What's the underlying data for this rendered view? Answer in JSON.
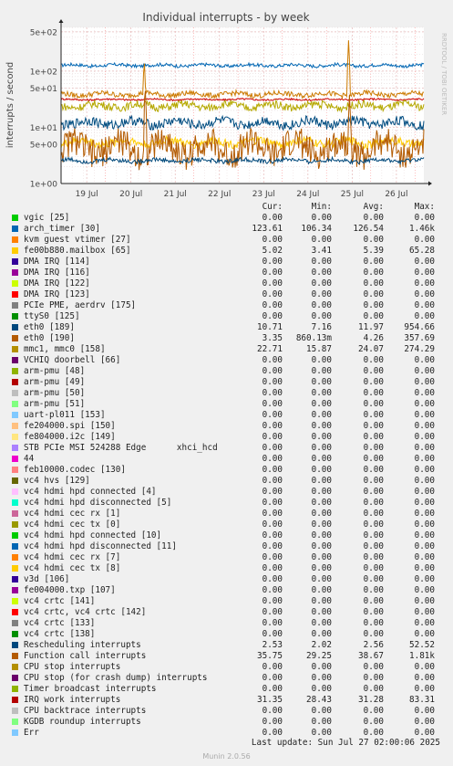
{
  "title": "Individual interrupts - by week",
  "ylabel": "interrupts / second",
  "watermark": "RRDTOOL / TOBI OETIKER",
  "columns": [
    "Cur:",
    "Min:",
    "Avg:",
    "Max:"
  ],
  "last_update": "Last update: Sun Jul 27 02:00:06 2025",
  "munin": "Munin 2.0.56",
  "chart_data": {
    "type": "line",
    "yscale": "log",
    "ylim": [
      1,
      600
    ],
    "yticks": [
      {
        "v": 500,
        "label": "5e+02"
      },
      {
        "v": 100,
        "label": "1e+02"
      },
      {
        "v": 50,
        "label": "5e+01"
      },
      {
        "v": 10,
        "label": "1e+01"
      },
      {
        "v": 5,
        "label": "5e+00"
      },
      {
        "v": 1,
        "label": "1e+00"
      }
    ],
    "xlim": [
      0,
      8.2
    ],
    "xticks": [
      {
        "v": 0.58,
        "label": "19 Jul"
      },
      {
        "v": 1.58,
        "label": "20 Jul"
      },
      {
        "v": 2.58,
        "label": "21 Jul"
      },
      {
        "v": 3.58,
        "label": "22 Jul"
      },
      {
        "v": 4.58,
        "label": "23 Jul"
      },
      {
        "v": 5.58,
        "label": "24 Jul"
      },
      {
        "v": 6.58,
        "label": "25 Jul"
      },
      {
        "v": 7.58,
        "label": "26 Jul"
      }
    ],
    "grid": true,
    "series": [
      {
        "name": "arch_timer [30]",
        "color": "#0066b3",
        "avg": 126.54,
        "lo": 106.34,
        "spikes": []
      },
      {
        "name": "IRQ work interrupts",
        "color": "#cc0000",
        "avg": 31.28,
        "lo": 28.43,
        "spikes": []
      },
      {
        "name": "Function call interrupts",
        "color": "#cc7a00",
        "avg": 38.67,
        "lo": 29.25,
        "spikes": [
          [
            1.88,
            180
          ],
          [
            6.5,
            380
          ]
        ]
      },
      {
        "name": "mmc1, mmc0 [158]",
        "color": "#b5a800",
        "avg": 24.07,
        "lo": 15.87,
        "spikes": []
      },
      {
        "name": "eth0 [189]",
        "color": "#004c80",
        "avg": 11.97,
        "lo": 7.16,
        "spikes": []
      },
      {
        "name": "fe00b880.mailbox [65]",
        "color": "#ffcc00",
        "avg": 5.39,
        "lo": 3.41,
        "spikes": []
      },
      {
        "name": "eth0 [190]",
        "color": "#b35a00",
        "avg": 4.26,
        "lo": 0.86,
        "spikes": [
          [
            1.9,
            60
          ],
          [
            6.52,
            40
          ]
        ]
      },
      {
        "name": "Rescheduling interrupts",
        "color": "#00487a",
        "avg": 2.56,
        "lo": 2.02,
        "spikes": []
      }
    ]
  },
  "legend": [
    {
      "name": "vgic [25]",
      "color": "#00cc00",
      "cur": "0.00",
      "min": "0.00",
      "avg": "0.00",
      "max": "0.00"
    },
    {
      "name": "arch_timer [30]",
      "color": "#0066b3",
      "cur": "123.61",
      "min": "106.34",
      "avg": "126.54",
      "max": "1.46k"
    },
    {
      "name": "kvm guest vtimer [27]",
      "color": "#ff8000",
      "cur": "0.00",
      "min": "0.00",
      "avg": "0.00",
      "max": "0.00"
    },
    {
      "name": "fe00b880.mailbox [65]",
      "color": "#ffcc00",
      "cur": "5.02",
      "min": "3.41",
      "avg": "5.39",
      "max": "65.28"
    },
    {
      "name": "DMA IRQ [114]",
      "color": "#330099",
      "cur": "0.00",
      "min": "0.00",
      "avg": "0.00",
      "max": "0.00"
    },
    {
      "name": "DMA IRQ [116]",
      "color": "#990099",
      "cur": "0.00",
      "min": "0.00",
      "avg": "0.00",
      "max": "0.00"
    },
    {
      "name": "DMA IRQ [122]",
      "color": "#ccff00",
      "cur": "0.00",
      "min": "0.00",
      "avg": "0.00",
      "max": "0.00"
    },
    {
      "name": "DMA IRQ [123]",
      "color": "#ff0000",
      "cur": "0.00",
      "min": "0.00",
      "avg": "0.00",
      "max": "0.00"
    },
    {
      "name": "PCIe PME, aerdrv [175]",
      "color": "#808080",
      "cur": "0.00",
      "min": "0.00",
      "avg": "0.00",
      "max": "0.00"
    },
    {
      "name": "ttyS0 [125]",
      "color": "#008f00",
      "cur": "0.00",
      "min": "0.00",
      "avg": "0.00",
      "max": "0.00"
    },
    {
      "name": "eth0 [189]",
      "color": "#00487d",
      "cur": "10.71",
      "min": "7.16",
      "avg": "11.97",
      "max": "954.66"
    },
    {
      "name": "eth0 [190]",
      "color": "#b35a00",
      "cur": "3.35",
      "min": "860.13m",
      "avg": "4.26",
      "max": "357.69"
    },
    {
      "name": "mmc1, mmc0 [158]",
      "color": "#b38f00",
      "cur": "22.71",
      "min": "15.87",
      "avg": "24.07",
      "max": "274.29"
    },
    {
      "name": "VCHIQ doorbell [66]",
      "color": "#6b006b",
      "cur": "0.00",
      "min": "0.00",
      "avg": "0.00",
      "max": "0.00"
    },
    {
      "name": "arm-pmu [48]",
      "color": "#8fb300",
      "cur": "0.00",
      "min": "0.00",
      "avg": "0.00",
      "max": "0.00"
    },
    {
      "name": "arm-pmu [49]",
      "color": "#b30000",
      "cur": "0.00",
      "min": "0.00",
      "avg": "0.00",
      "max": "0.00"
    },
    {
      "name": "arm-pmu [50]",
      "color": "#bebebe",
      "cur": "0.00",
      "min": "0.00",
      "avg": "0.00",
      "max": "0.00"
    },
    {
      "name": "arm-pmu [51]",
      "color": "#80ff80",
      "cur": "0.00",
      "min": "0.00",
      "avg": "0.00",
      "max": "0.00"
    },
    {
      "name": "uart-pl011 [153]",
      "color": "#80c9ff",
      "cur": "0.00",
      "min": "0.00",
      "avg": "0.00",
      "max": "0.00"
    },
    {
      "name": "fe204000.spi [150]",
      "color": "#ffc080",
      "cur": "0.00",
      "min": "0.00",
      "avg": "0.00",
      "max": "0.00"
    },
    {
      "name": "fe804000.i2c [149]",
      "color": "#ffe680",
      "cur": "0.00",
      "min": "0.00",
      "avg": "0.00",
      "max": "0.00"
    },
    {
      "name": "STB PCIe MSI 524288 Edge      xhci_hcd",
      "color": "#aa80ff",
      "cur": "0.00",
      "min": "0.00",
      "avg": "0.00",
      "max": "0.00"
    },
    {
      "name": "44",
      "color": "#ee00cc",
      "cur": "0.00",
      "min": "0.00",
      "avg": "0.00",
      "max": "0.00"
    },
    {
      "name": "feb10000.codec [130]",
      "color": "#ff8080",
      "cur": "0.00",
      "min": "0.00",
      "avg": "0.00",
      "max": "0.00"
    },
    {
      "name": "vc4 hvs [129]",
      "color": "#666600",
      "cur": "0.00",
      "min": "0.00",
      "avg": "0.00",
      "max": "0.00"
    },
    {
      "name": "vc4 hdmi hpd connected [4]",
      "color": "#ffbfff",
      "cur": "0.00",
      "min": "0.00",
      "avg": "0.00",
      "max": "0.00"
    },
    {
      "name": "vc4 hdmi hpd disconnected [5]",
      "color": "#00ffcc",
      "cur": "0.00",
      "min": "0.00",
      "avg": "0.00",
      "max": "0.00"
    },
    {
      "name": "vc4 hdmi cec rx [1]",
      "color": "#cc6699",
      "cur": "0.00",
      "min": "0.00",
      "avg": "0.00",
      "max": "0.00"
    },
    {
      "name": "vc4 hdmi cec tx [0]",
      "color": "#999900",
      "cur": "0.00",
      "min": "0.00",
      "avg": "0.00",
      "max": "0.00"
    },
    {
      "name": "vc4 hdmi hpd connected [10]",
      "color": "#00cc00",
      "cur": "0.00",
      "min": "0.00",
      "avg": "0.00",
      "max": "0.00"
    },
    {
      "name": "vc4 hdmi hpd disconnected [11]",
      "color": "#0066b3",
      "cur": "0.00",
      "min": "0.00",
      "avg": "0.00",
      "max": "0.00"
    },
    {
      "name": "vc4 hdmi cec rx [7]",
      "color": "#ff8000",
      "cur": "0.00",
      "min": "0.00",
      "avg": "0.00",
      "max": "0.00"
    },
    {
      "name": "vc4 hdmi cec tx [8]",
      "color": "#ffcc00",
      "cur": "0.00",
      "min": "0.00",
      "avg": "0.00",
      "max": "0.00"
    },
    {
      "name": "v3d [106]",
      "color": "#330099",
      "cur": "0.00",
      "min": "0.00",
      "avg": "0.00",
      "max": "0.00"
    },
    {
      "name": "fe004000.txp [107]",
      "color": "#990099",
      "cur": "0.00",
      "min": "0.00",
      "avg": "0.00",
      "max": "0.00"
    },
    {
      "name": "vc4 crtc [141]",
      "color": "#ccff00",
      "cur": "0.00",
      "min": "0.00",
      "avg": "0.00",
      "max": "0.00"
    },
    {
      "name": "vc4 crtc, vc4 crtc [142]",
      "color": "#ff0000",
      "cur": "0.00",
      "min": "0.00",
      "avg": "0.00",
      "max": "0.00"
    },
    {
      "name": "vc4 crtc [133]",
      "color": "#808080",
      "cur": "0.00",
      "min": "0.00",
      "avg": "0.00",
      "max": "0.00"
    },
    {
      "name": "vc4 crtc [138]",
      "color": "#008f00",
      "cur": "0.00",
      "min": "0.00",
      "avg": "0.00",
      "max": "0.00"
    },
    {
      "name": "Rescheduling interrupts",
      "color": "#00487d",
      "cur": "2.53",
      "min": "2.02",
      "avg": "2.56",
      "max": "52.52"
    },
    {
      "name": "Function call interrupts",
      "color": "#b35a00",
      "cur": "35.75",
      "min": "29.25",
      "avg": "38.67",
      "max": "1.81k"
    },
    {
      "name": "CPU stop interrupts",
      "color": "#b38f00",
      "cur": "0.00",
      "min": "0.00",
      "avg": "0.00",
      "max": "0.00"
    },
    {
      "name": "CPU stop (for crash dump) interrupts",
      "color": "#6b006b",
      "cur": "0.00",
      "min": "0.00",
      "avg": "0.00",
      "max": "0.00"
    },
    {
      "name": "Timer broadcast interrupts",
      "color": "#8fb300",
      "cur": "0.00",
      "min": "0.00",
      "avg": "0.00",
      "max": "0.00"
    },
    {
      "name": "IRQ work interrupts",
      "color": "#b30000",
      "cur": "31.35",
      "min": "28.43",
      "avg": "31.28",
      "max": "83.31"
    },
    {
      "name": "CPU backtrace interrupts",
      "color": "#bebebe",
      "cur": "0.00",
      "min": "0.00",
      "avg": "0.00",
      "max": "0.00"
    },
    {
      "name": "KGDB roundup interrupts",
      "color": "#80ff80",
      "cur": "0.00",
      "min": "0.00",
      "avg": "0.00",
      "max": "0.00"
    },
    {
      "name": "Err",
      "color": "#80c9ff",
      "cur": "0.00",
      "min": "0.00",
      "avg": "0.00",
      "max": "0.00"
    }
  ]
}
